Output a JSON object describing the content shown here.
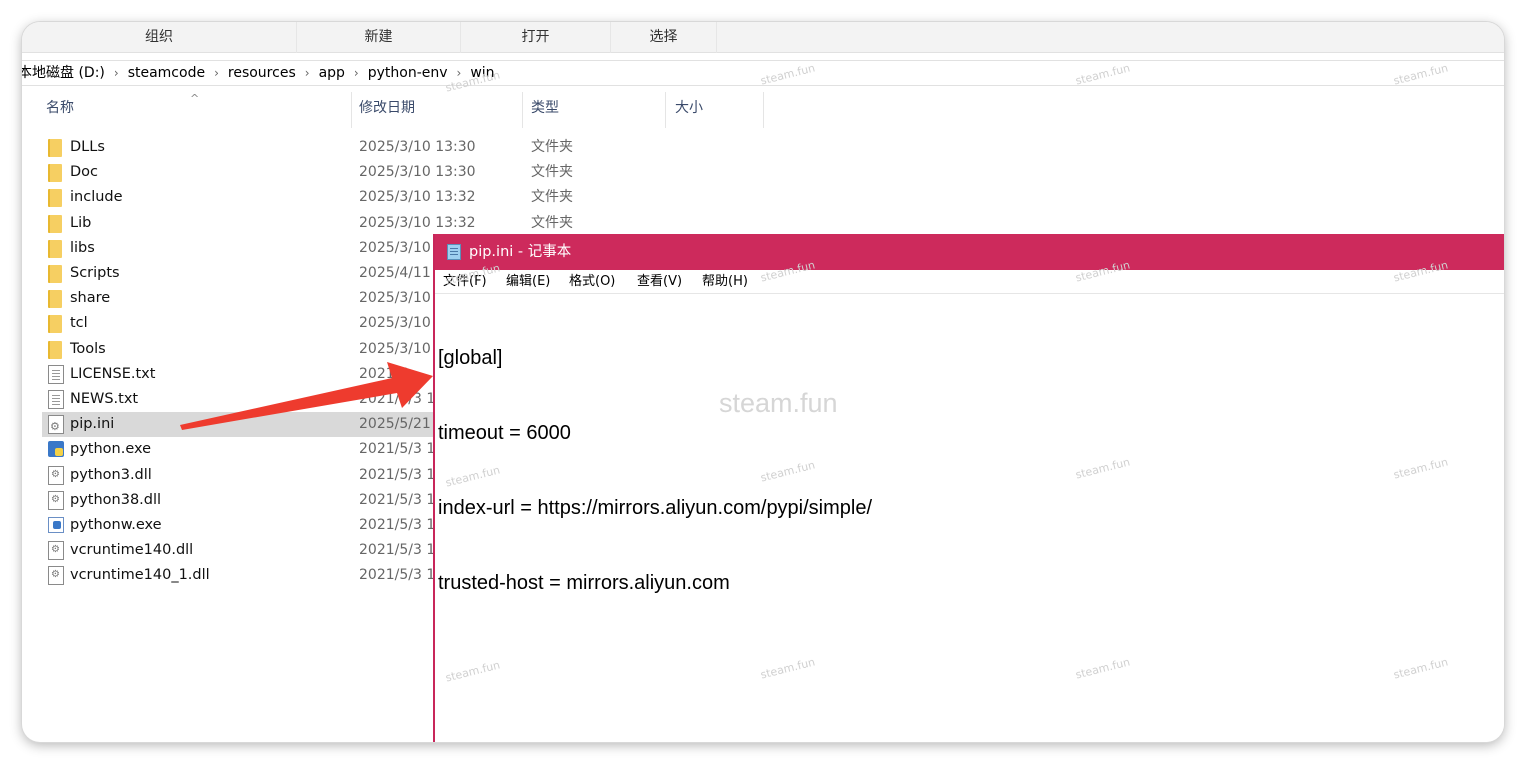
{
  "explorer": {
    "toolbar": {
      "organize": "组织",
      "new": "新建",
      "open": "打开",
      "select": "选择"
    },
    "breadcrumb": [
      "本地磁盘 (D:)",
      "steamcode",
      "resources",
      "app",
      "python-env",
      "win"
    ],
    "columns": {
      "name": "名称",
      "date": "修改日期",
      "type": "类型",
      "size": "大小"
    },
    "files": [
      {
        "name": "DLLs",
        "date": "2025/3/10 13:30",
        "type": "文件夹",
        "icon": "folder-icon"
      },
      {
        "name": "Doc",
        "date": "2025/3/10 13:30",
        "type": "文件夹",
        "icon": "folder-icon"
      },
      {
        "name": "include",
        "date": "2025/3/10 13:32",
        "type": "文件夹",
        "icon": "folder-icon"
      },
      {
        "name": "Lib",
        "date": "2025/3/10 13:32",
        "type": "文件夹",
        "icon": "folder-icon"
      },
      {
        "name": "libs",
        "date": "2025/3/10",
        "type": "",
        "icon": "folder-icon"
      },
      {
        "name": "Scripts",
        "date": "2025/4/11",
        "type": "",
        "icon": "folder-icon"
      },
      {
        "name": "share",
        "date": "2025/3/10",
        "type": "",
        "icon": "folder-icon"
      },
      {
        "name": "tcl",
        "date": "2025/3/10",
        "type": "",
        "icon": "folder-icon"
      },
      {
        "name": "Tools",
        "date": "2025/3/10",
        "type": "",
        "icon": "folder-icon"
      },
      {
        "name": "LICENSE.txt",
        "date": "2021/5",
        "type": "",
        "icon": "text-file-icon"
      },
      {
        "name": "NEWS.txt",
        "date": "2021/5/3 1",
        "type": "",
        "icon": "text-file-icon"
      },
      {
        "name": "pip.ini",
        "date": "2025/5/21",
        "type": "",
        "icon": "ini-file-icon",
        "selected": true
      },
      {
        "name": "python.exe",
        "date": "2021/5/3 1",
        "type": "",
        "icon": "python-exe-icon"
      },
      {
        "name": "python3.dll",
        "date": "2021/5/3 1",
        "type": "",
        "icon": "dll-file-icon"
      },
      {
        "name": "python38.dll",
        "date": "2021/5/3 1",
        "type": "",
        "icon": "dll-file-icon"
      },
      {
        "name": "pythonw.exe",
        "date": "2021/5/3 1",
        "type": "",
        "icon": "pythonw-exe-icon"
      },
      {
        "name": "vcruntime140.dll",
        "date": "2021/5/3 1",
        "type": "",
        "icon": "dll-file-icon"
      },
      {
        "name": "vcruntime140_1.dll",
        "date": "2021/5/3 1",
        "type": "",
        "icon": "dll-file-icon"
      }
    ]
  },
  "notepad": {
    "title": "pip.ini - 记事本",
    "title_bar_color": "#cd2a5c",
    "menu": [
      "文件(F)",
      "编辑(E)",
      "格式(O)",
      "查看(V)",
      "帮助(H)"
    ],
    "lines": [
      "[global]",
      "timeout = 6000",
      "index-url = https://mirrors.aliyun.com/pypi/simple/",
      "trusted-host = mirrors.aliyun.com"
    ]
  },
  "watermark": {
    "small": "steam.fun",
    "large": "steam.fun"
  },
  "annotation": {
    "arrow_color": "#ee3b2e"
  }
}
